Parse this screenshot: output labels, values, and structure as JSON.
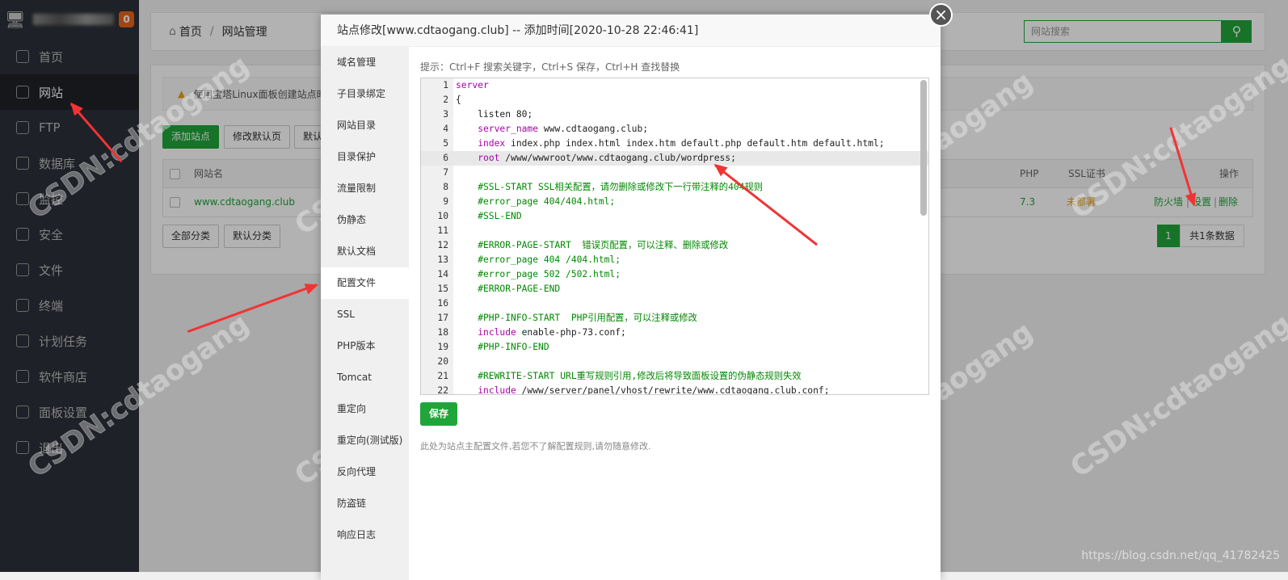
{
  "sidebar": {
    "badge": "0",
    "items": [
      {
        "label": "首页"
      },
      {
        "label": "网站"
      },
      {
        "label": "FTP"
      },
      {
        "label": "数据库"
      },
      {
        "label": "监控"
      },
      {
        "label": "安全"
      },
      {
        "label": "文件"
      },
      {
        "label": "终端"
      },
      {
        "label": "计划任务"
      },
      {
        "label": "软件商店"
      },
      {
        "label": "面板设置"
      },
      {
        "label": "退出"
      }
    ]
  },
  "breadcrumb": {
    "home": "首页",
    "sep": "/",
    "current": "网站管理"
  },
  "search": {
    "placeholder": "网站搜索"
  },
  "warning": "使用宝塔Linux面板创建站点时",
  "toolbar": {
    "add": "添加站点",
    "default_page": "修改默认页",
    "default_site": "默认"
  },
  "table": {
    "headers": {
      "name": "网站名",
      "php": "PHP",
      "ssl": "SSL证书",
      "ops": "操作"
    },
    "row": {
      "name": "www.cdtaogang.club",
      "php": "7.3",
      "ssl": "未部署",
      "firewall": "防火墙",
      "settings": "设置",
      "delete": "删除",
      "sep": "|"
    }
  },
  "filters": {
    "all": "全部分类",
    "default": "默认分类"
  },
  "pagination": {
    "page": "1",
    "total": "共1条数据"
  },
  "modal": {
    "title": "站点修改[www.cdtaogang.club] -- 添加时间[2020-10-28 22:46:41]",
    "close": "×",
    "nav": [
      "域名管理",
      "子目录绑定",
      "网站目录",
      "目录保护",
      "流量限制",
      "伪静态",
      "默认文档",
      "配置文件",
      "SSL",
      "PHP版本",
      "Tomcat",
      "重定向",
      "重定向(测试版)",
      "反向代理",
      "防盗链",
      "响应日志"
    ],
    "active_nav": "配置文件",
    "tip": "提示：Ctrl+F 搜索关键字，Ctrl+S 保存，Ctrl+H 查找替换",
    "code": [
      [
        [
          "server",
          "k"
        ]
      ],
      [
        [
          "{",
          "t"
        ]
      ],
      [
        [
          "    listen 80;",
          "t"
        ]
      ],
      [
        [
          "    ",
          "t"
        ],
        [
          "server_name",
          "k"
        ],
        [
          " www.cdtaogang.club;",
          "t"
        ]
      ],
      [
        [
          "    ",
          "t"
        ],
        [
          "index",
          "k"
        ],
        [
          " index.php index.html index.htm default.php default.htm default.html;",
          "t"
        ]
      ],
      [
        [
          "    ",
          "t"
        ],
        [
          "root",
          "k"
        ],
        [
          " /www/wwwroot/www.cdtaogang.club/wordpress;",
          "t"
        ]
      ],
      [],
      [
        [
          "    #SSL-START SSL相关配置，请勿删除或修改下一行带注释的404规则",
          "c"
        ]
      ],
      [
        [
          "    #error_page 404/404.html;",
          "c"
        ]
      ],
      [
        [
          "    #SSL-END",
          "c"
        ]
      ],
      [],
      [
        [
          "    #ERROR-PAGE-START  错误页配置，可以注释、删除或修改",
          "c"
        ]
      ],
      [
        [
          "    #error_page 404 /404.html;",
          "c"
        ]
      ],
      [
        [
          "    #error_page 502 /502.html;",
          "c"
        ]
      ],
      [
        [
          "    #ERROR-PAGE-END",
          "c"
        ]
      ],
      [],
      [
        [
          "    #PHP-INFO-START  PHP引用配置，可以注释或修改",
          "c"
        ]
      ],
      [
        [
          "    ",
          "t"
        ],
        [
          "include",
          "k"
        ],
        [
          " enable-php-73.conf;",
          "t"
        ]
      ],
      [
        [
          "    #PHP-INFO-END",
          "c"
        ]
      ],
      [],
      [
        [
          "    #REWRITE-START URL重写规则引用,修改后将导致面板设置的伪静态规则失效",
          "c"
        ]
      ],
      [
        [
          "    ",
          "t"
        ],
        [
          "include",
          "k"
        ],
        [
          " /www/server/panel/vhost/rewrite/www.cdtaogang.club.conf;",
          "t"
        ]
      ]
    ],
    "current_line": 6,
    "save": "保存",
    "note": "此处为站点主配置文件,若您不了解配置规则,请勿随意修改."
  },
  "watermark": "CSDN:cdtaogang",
  "footer_url": "https://blog.csdn.net/qq_41782425",
  "colors": {
    "accent": "#20a53a",
    "badge": "#e86418",
    "warning_ssl": "#e8a317",
    "arrow": "#f03434"
  }
}
